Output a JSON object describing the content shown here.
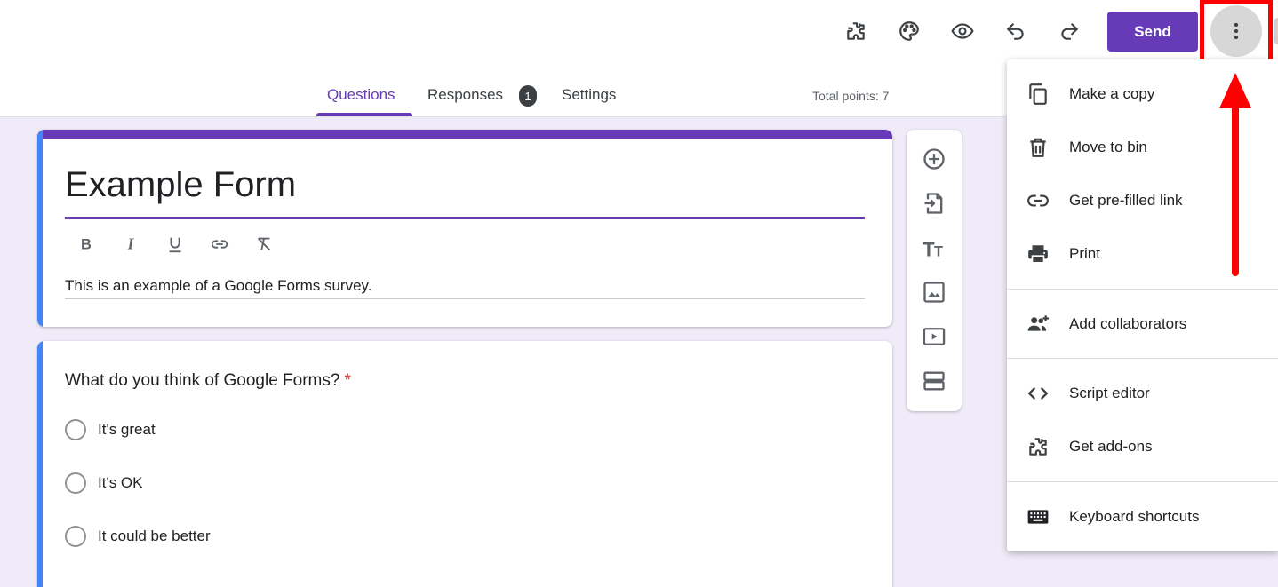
{
  "header": {
    "send_label": "Send",
    "icons": [
      "addon-icon",
      "palette-icon",
      "preview-icon",
      "undo-icon",
      "redo-icon",
      "more-vert-icon"
    ]
  },
  "tabs": {
    "questions": "Questions",
    "responses": "Responses",
    "responses_badge": "1",
    "settings": "Settings",
    "total_points": "Total points: 7"
  },
  "form": {
    "title": "Example Form",
    "description": "This is an example of a Google Forms survey."
  },
  "question": {
    "text": "What do you think of Google Forms?",
    "required_mark": "*",
    "options": [
      "It's great",
      "It's OK",
      "It could be better"
    ]
  },
  "menu": {
    "items": [
      {
        "label": "Make a copy",
        "icon": "copy-icon"
      },
      {
        "label": "Move to bin",
        "icon": "trash-icon"
      },
      {
        "label": "Get pre-filled link",
        "icon": "link-icon"
      },
      {
        "label": "Print",
        "icon": "print-icon"
      },
      {
        "label": "Add collaborators",
        "icon": "add-people-icon"
      },
      {
        "label": "Script editor",
        "icon": "code-icon"
      },
      {
        "label": "Get add-ons",
        "icon": "addon-icon"
      },
      {
        "label": "Keyboard shortcuts",
        "icon": "keyboard-icon"
      }
    ]
  },
  "colors": {
    "accent": "#673ab7",
    "canvas": "#f0ebf8",
    "card_edge": "#4285f4",
    "annotation": "#ff0000"
  }
}
